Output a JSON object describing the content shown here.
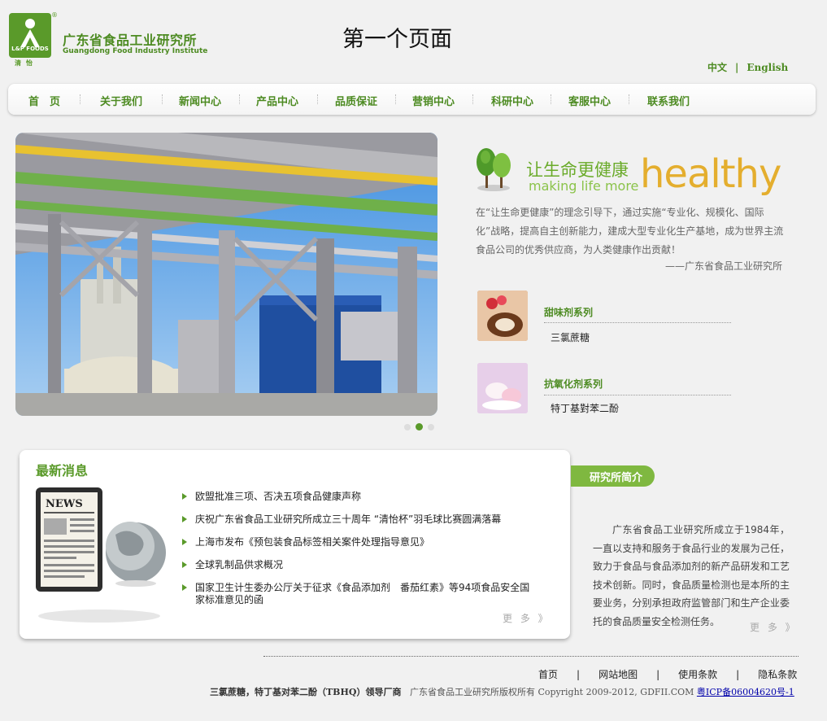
{
  "header": {
    "logo_brand": "L&P FOODS",
    "logo_sub": "清怡",
    "logo_reg": "®",
    "brand_cn": "广东省食品工业研究所",
    "brand_en": "Guangdong Food Industry Institute",
    "page_title": "第一个页面",
    "lang_cn": "中文",
    "lang_sep": "|",
    "lang_en": "English"
  },
  "nav": {
    "items": [
      "首　页",
      "关于我们",
      "新闻中心",
      "产品中心",
      "品质保证",
      "营销中心",
      "科研中心",
      "客服中心",
      "联系我们"
    ]
  },
  "banner": {
    "slide_count": 3,
    "active_slide": 2
  },
  "slogan": {
    "cn": "让生命更健康",
    "en": "making life more",
    "big": "healthy",
    "intro": "在“让生命更健康”的理念引导下，通过实施“专业化、规模化、国际化”战略，提高自主创新能力，建成大型专业化生产基地，成为世界主流食品公司的优秀供应商，为人类健康作出贡献！",
    "sign": "——广东省食品工业研究所"
  },
  "products": [
    {
      "title": "甜味剂系列",
      "item": "三氯蔗糖"
    },
    {
      "title": "抗氧化剂系列",
      "item": "特丁基對苯二酚"
    }
  ],
  "news": {
    "title": "最新消息",
    "items": [
      "欧盟批准三项、否决五项食品健康声称",
      "庆祝广东省食品工业研究所成立三十周年 “清怡杯”羽毛球比赛圆满落幕",
      "上海市发布《预包装食品标签相关案件处理指导意见》",
      "全球乳制品供求概况",
      "国家卫生计生委办公厅关于征求《食品添加剂　番茄红素》等94项食品安全国家标准意见的函"
    ],
    "more": "更 多 》"
  },
  "about": {
    "tab": "研究所简介",
    "text": "广东省食品工业研究所成立于1984年，一直以支持和服务于食品行业的发展为己任，致力于食品与食品添加剂的新产品研发和工艺技术创新。同时，食品质量检测也是本所的主要业务，分别承担政府监管部门和生产企业委托的食品质量安全检测任务。",
    "more": "更 多 》"
  },
  "footer": {
    "links": [
      "首页",
      "网站地图",
      "使用条款",
      "隐私条款"
    ],
    "sep": "|",
    "tagline": "三氯蔗糖，特丁基对苯二酚（TBHQ）领导厂商",
    "copyright": "广东省食品工业研究所版权所有 Copyright 2009-2012, GDFII.COM",
    "icp": "粤ICP备06004620号-1"
  },
  "colors": {
    "brand_green": "#4d8b22",
    "accent_yellow": "#e4ae2e",
    "tab_green": "#7fb840"
  }
}
